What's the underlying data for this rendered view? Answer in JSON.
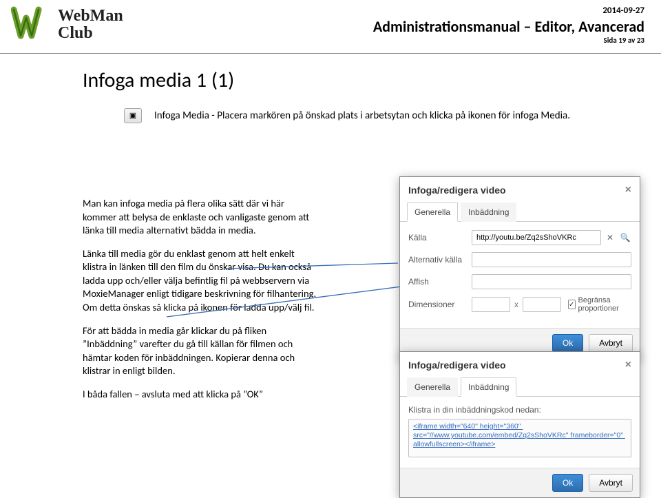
{
  "header": {
    "logo": {
      "line1": "WebMan",
      "line2": "Club"
    },
    "date": "2014-09-27",
    "title": "Administrationsmanual – Editor, Avancerad",
    "page": "Sida 19 av 23"
  },
  "page_title": "Infoga media  1 (1)",
  "intro": "Infoga Media  -  Placera markören på önskad plats i arbetsytan och klicka på ikonen för infoga Media.",
  "media_btn_icon": "▣",
  "paragraphs": {
    "p1": "Man kan infoga media på flera olika sätt där vi här kommer att belysa de enklaste och vanligaste genom att länka till media alternativt bädda in media.",
    "p2": "Länka till media gör du enklast genom att helt enkelt klistra in länken till den film du önskar visa. Du kan också ladda upp och/eller välja befintlig fil på webbservern via MoxieManager enligt tidigare beskrivning för filhantering. Om detta önskas så klicka på ikonen för ladda upp/välj fil.",
    "p3": "För att bädda in media går klickar du på fliken ”Inbäddning” varefter du gå till källan för filmen och hämtar koden för inbäddningen. Kopierar denna och klistrar in enligt bilden.",
    "p4": "I båda fallen – avsluta med att klicka på ”OK”"
  },
  "dialog1": {
    "title": "Infoga/redigera video",
    "tabs": {
      "general": "Generella",
      "embed": "Inbäddning"
    },
    "labels": {
      "source": "Källa",
      "alt_source": "Alternativ källa",
      "poster": "Affish",
      "dimensions": "Dimensioner"
    },
    "source_value": "http://youtu.be/Zq2sShoVKRc",
    "constrain": "Begränsa proportioner",
    "ok": "Ok",
    "cancel": "Avbryt",
    "dim_sep": "x",
    "clear_tooltip": "clear",
    "browse_tooltip": "browse"
  },
  "dialog2": {
    "title": "Infoga/redigera video",
    "tabs": {
      "general": "Generella",
      "embed": "Inbäddning"
    },
    "embed_label": "Klistra in din inbäddningskod nedan:",
    "embed_code": "<iframe width=\"640\" height=\"360\" src=\"//www.youtube.com/embed/Zq2sShoVKRc\" frameborder=\"0\" allowfullscreen></iframe>",
    "ok": "Ok",
    "cancel": "Avbryt"
  }
}
